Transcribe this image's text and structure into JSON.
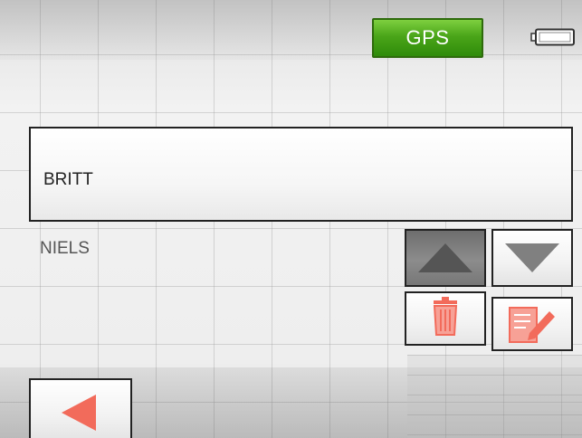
{
  "status_bar": {
    "gps_label": "GPS",
    "battery_icon": "battery-icon"
  },
  "list": {
    "items": [
      {
        "label": "BRITT",
        "selected": true
      },
      {
        "label": "NIELS",
        "selected": false
      }
    ]
  },
  "actions": {
    "up_icon": "arrow-up-icon",
    "down_icon": "arrow-down-icon",
    "delete_icon": "trash-icon",
    "edit_icon": "edit-icon",
    "back_icon": "back-arrow-icon"
  },
  "colors": {
    "gps_green": "#4aa519",
    "accent_red": "#f26b5b",
    "up_disabled_gray": "#555555"
  }
}
